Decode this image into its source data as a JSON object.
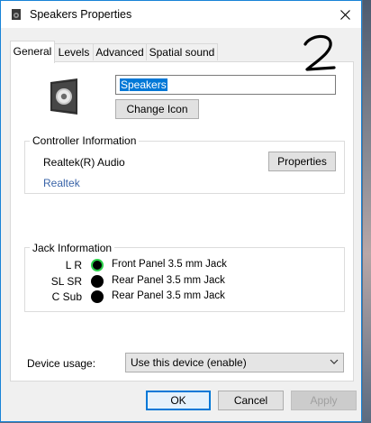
{
  "window": {
    "title": "Speakers Properties"
  },
  "tabs": [
    {
      "label": "General",
      "active": true
    },
    {
      "label": "Levels",
      "active": false
    },
    {
      "label": "Advanced",
      "active": false
    },
    {
      "label": "Spatial sound",
      "active": false
    }
  ],
  "handwritten_mark": "2",
  "general": {
    "device_name_value": "Speakers",
    "change_icon_label": "Change Icon",
    "controller": {
      "label": "Controller Information",
      "name": "Realtek(R) Audio",
      "vendor_link": "Realtek",
      "properties_label": "Properties"
    },
    "jack": {
      "label": "Jack Information",
      "rows": [
        {
          "channel": "L R",
          "description": "Front Panel 3.5 mm Jack",
          "connected": true
        },
        {
          "channel": "SL SR",
          "description": "Rear Panel 3.5 mm Jack",
          "connected": false
        },
        {
          "channel": "C Sub",
          "description": "Rear Panel 3.5 mm Jack",
          "connected": false
        }
      ]
    },
    "device_usage": {
      "label": "Device usage:",
      "selected": "Use this device (enable)"
    }
  },
  "footer": {
    "ok_label": "OK",
    "cancel_label": "Cancel",
    "apply_label": "Apply"
  },
  "colors": {
    "accent": "#0078d7",
    "window_border": "#1883d7",
    "link": "#3a64a8",
    "connected_ring": "#2bd04a",
    "disabled_text": "#a0a0a0"
  }
}
